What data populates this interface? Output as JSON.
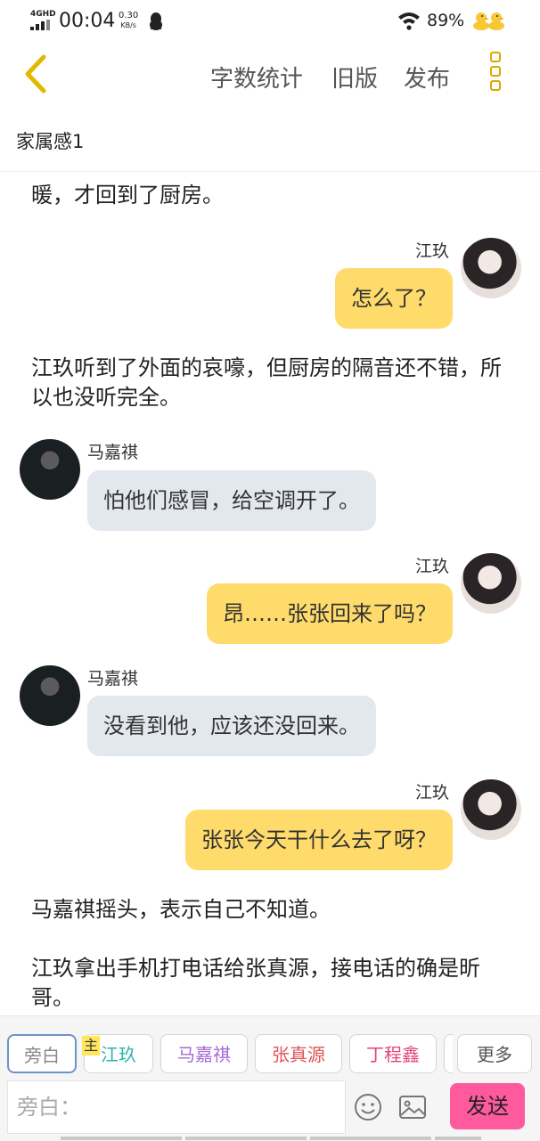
{
  "status_bar": {
    "network": "4GHD",
    "time": "00:04",
    "speed_value": "0.30",
    "speed_unit": "KB/s",
    "battery": "89%",
    "icons": [
      "signal-icon",
      "qq-penguin-icon",
      "wifi-icon",
      "ducks-icon"
    ]
  },
  "header": {
    "word_count": "字数统计",
    "old_version": "旧版",
    "publish": "发布",
    "icons": [
      "back-arrow-icon",
      "more-menu-icon"
    ]
  },
  "title": "家属感1",
  "story": {
    "top_fragment": "暖，才回到了厨房。",
    "messages": [
      {
        "type": "bubble",
        "speaker": "江玖",
        "side": "right",
        "text": "怎么了？"
      },
      {
        "type": "narration",
        "text": "江玖听到了外面的哀嚎，但厨房的隔音还不错，所以也没听完全。"
      },
      {
        "type": "bubble",
        "speaker": "马嘉祺",
        "side": "left",
        "text": "怕他们感冒，给空调开了。"
      },
      {
        "type": "bubble",
        "speaker": "江玖",
        "side": "right",
        "text": "昂……张张回来了吗？"
      },
      {
        "type": "bubble",
        "speaker": "马嘉祺",
        "side": "left",
        "text": "没看到他，应该还没回来。"
      },
      {
        "type": "bubble",
        "speaker": "江玖",
        "side": "right",
        "text": "张张今天干什么去了呀？"
      },
      {
        "type": "narration",
        "text": "马嘉祺摇头，表示自己不知道。"
      },
      {
        "type": "narration",
        "text": "江玖拿出手机打电话给张真源，接电话的确是昕哥。"
      }
    ]
  },
  "role_chips": [
    {
      "label": "旁白",
      "color": "#888888",
      "active": true
    },
    {
      "label": "江玖",
      "color": "#2fb4a8",
      "main": true
    },
    {
      "label": "马嘉祺",
      "color": "#a56ad6"
    },
    {
      "label": "张真源",
      "color": "#e05353"
    },
    {
      "label": "丁程鑫",
      "color": "#e0457a"
    }
  ],
  "main_tag": "主",
  "more_label": "更多",
  "input": {
    "placeholder": "旁白："
  },
  "send_label": "发送",
  "colors": {
    "accent_yellow": "#fedb6b",
    "bubble_gray": "#e3e8ef",
    "send_pink": "#ff5a9d",
    "back_arrow": "#e3b800"
  }
}
